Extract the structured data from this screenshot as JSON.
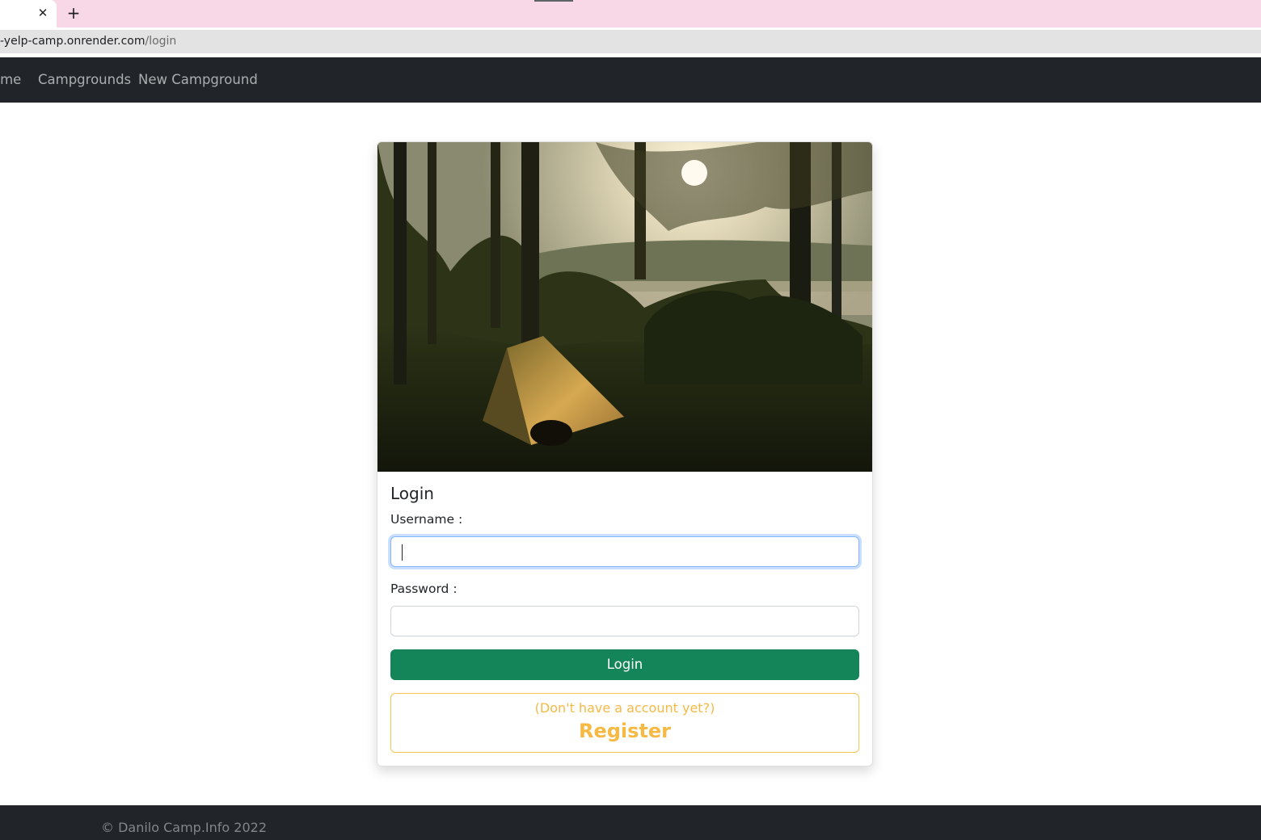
{
  "browser": {
    "tab_close": "✕",
    "new_tab": "+",
    "url_host": "-yelp-camp.onrender.com",
    "url_path": "/login"
  },
  "navbar": {
    "items": [
      {
        "label": "ome"
      },
      {
        "label": "Campgrounds"
      },
      {
        "label": "New Campground"
      }
    ]
  },
  "login": {
    "title": "Login",
    "username_label": "Username :",
    "username_value": "",
    "password_label": "Password :",
    "password_value": "",
    "submit_label": "Login",
    "register_hint": "(Don't have a account yet?)",
    "register_label": "Register"
  },
  "footer": {
    "text": "© Danilo Camp.Info 2022"
  },
  "colors": {
    "navbar_bg": "#212529",
    "login_button": "#138558",
    "register_accent": "#f5b944",
    "tab_strip": "#f8d7e6"
  }
}
